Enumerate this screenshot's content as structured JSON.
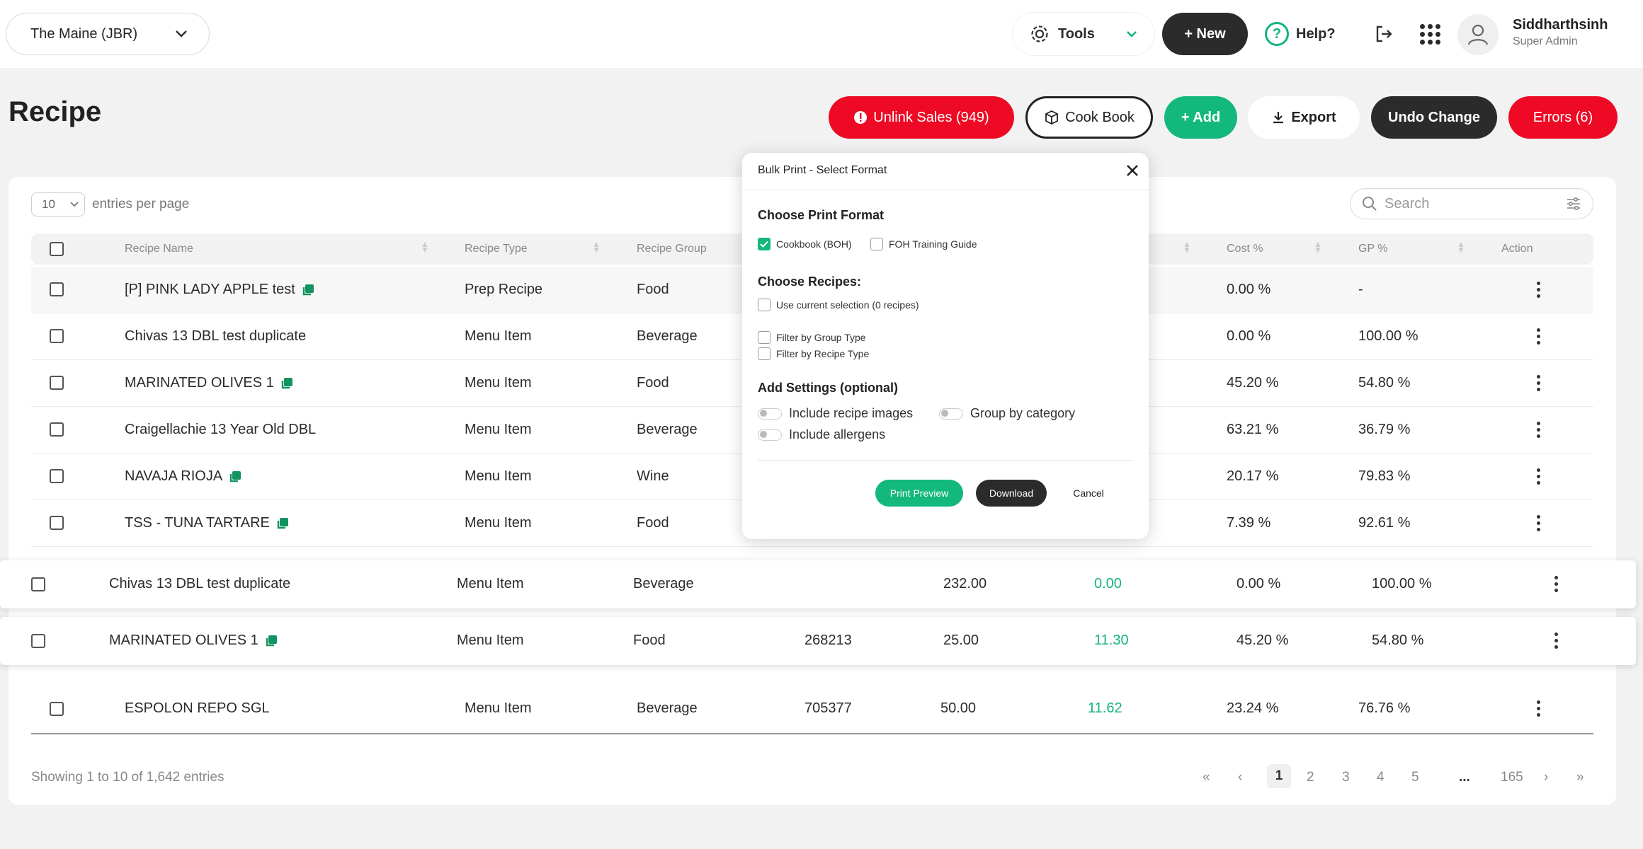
{
  "header": {
    "store": "The Maine (JBR)",
    "tools_label": "Tools",
    "new_label": "+ New",
    "help_label": "Help?",
    "user_name": "Siddharthsinh",
    "user_role": "Super Admin"
  },
  "page": {
    "title": "Recipe",
    "unlink_label": "Unlink Sales (949)",
    "cookbook_label": "Cook Book",
    "add_label": "+ Add",
    "export_label": "Export",
    "undo_label": "Undo Change",
    "errors_label": "Errors (6)"
  },
  "table": {
    "entries_value": "10",
    "entries_label": "entries per page",
    "search_placeholder": "Search",
    "columns": {
      "name": "Recipe Name",
      "type": "Recipe Type",
      "group": "Recipe Group",
      "cost": "Cost %",
      "gp": "GP %",
      "action": "Action"
    },
    "rows": [
      {
        "name": "[P] PINK LADY APPLE test",
        "type": "Prep Recipe",
        "group": "Food",
        "cost": "0.00 %",
        "gp": "-"
      },
      {
        "name": "Chivas 13 DBL test duplicate",
        "type": "Menu Item",
        "group": "Beverage",
        "cost": "0.00 %",
        "gp": "100.00 %"
      },
      {
        "name": "MARINATED OLIVES 1",
        "type": "Menu Item",
        "group": "Food",
        "cost": "45.20 %",
        "gp": "54.80 %"
      },
      {
        "name": "Craigellachie 13 Year Old DBL",
        "type": "Menu Item",
        "group": "Beverage",
        "cost": "63.21 %",
        "gp": "36.79 %"
      },
      {
        "name": "NAVAJA RIOJA",
        "type": "Menu Item",
        "group": "Wine",
        "cost": "20.17 %",
        "gp": "79.83 %"
      },
      {
        "name": "TSS - TUNA TARTARE",
        "type": "Menu Item",
        "group": "Food",
        "cost": "7.39 %",
        "gp": "92.61 %"
      }
    ],
    "float_rows": [
      {
        "name": "Chivas 13 DBL test duplicate",
        "type": "Menu Item",
        "group": "Beverage",
        "code": "",
        "price": "232.00",
        "cost_value": "0.00",
        "cost": "0.00 %",
        "gp": "100.00 %"
      },
      {
        "name": "MARINATED OLIVES 1",
        "type": "Menu Item",
        "group": "Food",
        "code": "268213",
        "price": "25.00",
        "cost_value": "11.30",
        "cost": "45.20 %",
        "gp": "54.80 %"
      }
    ],
    "last_row": {
      "name": "ESPOLON REPO SGL",
      "type": "Menu Item",
      "group": "Beverage",
      "code": "705377",
      "price": "50.00",
      "cost_value": "11.62",
      "cost": "23.24 %",
      "gp": "76.76 %"
    },
    "showing": "Showing 1 to 10 of 1,642 entries",
    "pagination": {
      "first": "«",
      "prev": "‹",
      "pages": [
        "1",
        "2",
        "3",
        "4",
        "5"
      ],
      "ellipsis": "...",
      "last_page": "165",
      "next": "›",
      "last": "»"
    }
  },
  "modal": {
    "title": "Bulk Print - Select Format",
    "format_heading": "Choose Print Format",
    "format_cookbook": "Cookbook (BOH)",
    "format_foh": "FOH Training Guide",
    "recipes_heading": "Choose Recipes:",
    "use_current": "Use current selection (0 recipes)",
    "filter_group": "Filter by Group Type",
    "filter_recipe": "Filter by Recipe Type",
    "settings_heading": "Add Settings (optional)",
    "include_images": "Include recipe images",
    "group_by_category": "Group by category",
    "include_allergens": "Include allergens",
    "print_preview": "Print Preview",
    "download": "Download",
    "cancel": "Cancel"
  },
  "colors": {
    "accent_green": "#13b87c",
    "danger_red": "#ee0a24",
    "dark": "#2b2b2b"
  }
}
